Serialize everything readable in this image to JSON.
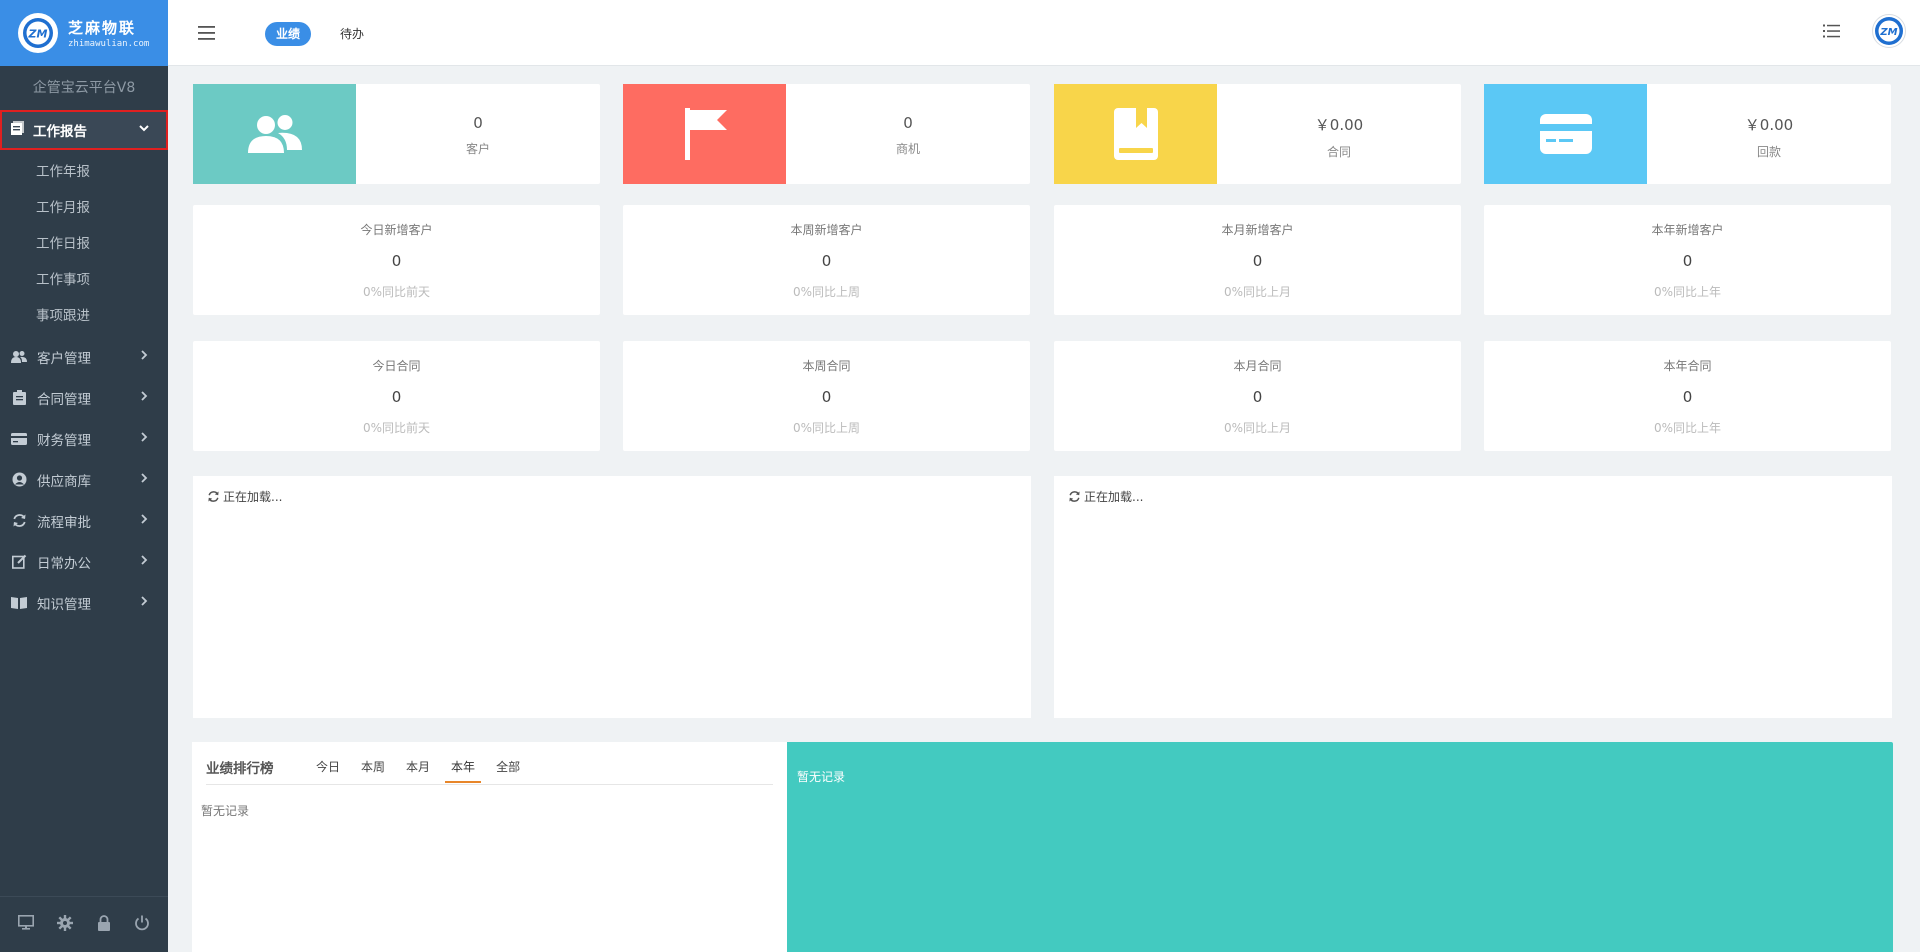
{
  "brand": {
    "title": "芝麻物联",
    "subtitle": "zhimawulian.com"
  },
  "sidebar": {
    "platform_title": "企管宝云平台V8",
    "active_menu": "工作报告",
    "submenu": [
      "工作年报",
      "工作月报",
      "工作日报",
      "工作事项",
      "事项跟进"
    ],
    "menus": [
      {
        "label": "客户管理",
        "icon": "users-icon"
      },
      {
        "label": "合同管理",
        "icon": "clipboard-icon"
      },
      {
        "label": "财务管理",
        "icon": "credit-card-icon"
      },
      {
        "label": "供应商库",
        "icon": "user-circle-icon"
      },
      {
        "label": "流程审批",
        "icon": "refresh-icon"
      },
      {
        "label": "日常办公",
        "icon": "edit-icon"
      },
      {
        "label": "知识管理",
        "icon": "book-open-icon"
      }
    ],
    "footer_icons": [
      "desktop-icon",
      "gear-icon",
      "lock-icon",
      "power-icon"
    ]
  },
  "topbar": {
    "tab_active": "业绩",
    "tab_other": "待办"
  },
  "summary_cards": [
    {
      "value": "0",
      "label": "客户",
      "color": "#6ccac4",
      "icon": "users-icon"
    },
    {
      "value": "0",
      "label": "商机",
      "color": "#fe6c61",
      "icon": "flag-icon"
    },
    {
      "value": "￥0.00",
      "label": "合同",
      "color": "#f8d54a",
      "icon": "book-icon"
    },
    {
      "value": "￥0.00",
      "label": "回款",
      "color": "#5bc8f5",
      "icon": "credit-card-icon"
    }
  ],
  "customer_stats": [
    {
      "title": "今日新增客户",
      "value": "0",
      "compare": "0%同比前天"
    },
    {
      "title": "本周新增客户",
      "value": "0",
      "compare": "0%同比上周"
    },
    {
      "title": "本月新增客户",
      "value": "0",
      "compare": "0%同比上月"
    },
    {
      "title": "本年新增客户",
      "value": "0",
      "compare": "0%同比上年"
    }
  ],
  "contract_stats": [
    {
      "title": "今日合同",
      "value": "0",
      "compare": "0%同比前天"
    },
    {
      "title": "本周合同",
      "value": "0",
      "compare": "0%同比上周"
    },
    {
      "title": "本月合同",
      "value": "0",
      "compare": "0%同比上月"
    },
    {
      "title": "本年合同",
      "value": "0",
      "compare": "0%同比上年"
    }
  ],
  "loading_panels": [
    {
      "text": "正在加载..."
    },
    {
      "text": "正在加载..."
    }
  ],
  "ranking": {
    "title": "业绩排行榜",
    "tabs": [
      "今日",
      "本周",
      "本月",
      "本年",
      "全部"
    ],
    "active_tab": "本年",
    "empty_text": "暂无记录"
  },
  "teal_panel": {
    "empty_text": "暂无记录",
    "color": "#43cac0"
  }
}
